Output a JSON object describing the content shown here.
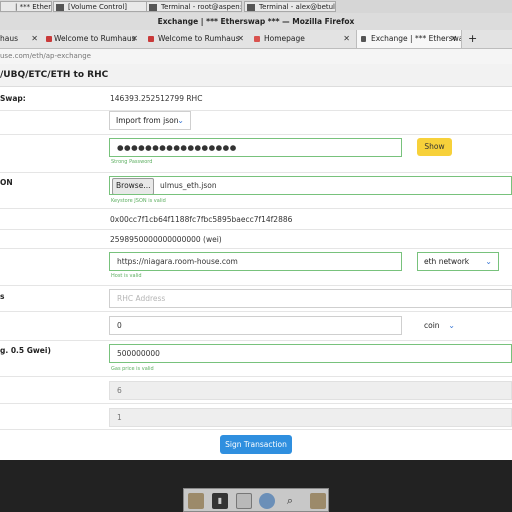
{
  "taskbar": {
    "items": [
      {
        "label": "| *** Ethersw..."
      },
      {
        "label": "[Volume Control]"
      },
      {
        "label": "Terminal - root@aspen:~"
      },
      {
        "label": "Terminal - alex@betula..."
      }
    ]
  },
  "window": {
    "title": "Exchange | *** Etherswap *** — Mozilla Firefox"
  },
  "tabs": [
    {
      "label": "haus"
    },
    {
      "label": "Welcome to Rumhaus"
    },
    {
      "label": "Welcome to Rumhaus"
    },
    {
      "label": "Homepage"
    },
    {
      "label": "Exchange | *** Etherswa"
    }
  ],
  "new_tab_label": "+",
  "url": "use.com/eth/ap-exchange",
  "page": {
    "title": "/UBQ/ETC/ETH to RHC",
    "rows": {
      "swap_label": "Swap:",
      "swap_value": "146393.252512799 RHC",
      "import_select": "Import from json",
      "password_value": "●●●●●●●●●●●●●●●●●",
      "password_hint": "Strong Password",
      "show_button": "Show",
      "json_label": "ON",
      "browse_button": "Browse...",
      "file_name": "ulmus_eth.json",
      "json_hint": "Keystore JSON is valid",
      "address_value": "0x00cc7f1cb64f1188fc7fbc5895baecc7f14f2886",
      "balance_value": "2598950000000000000 (wei)",
      "host_value": "https://niagara.room-house.com",
      "host_hint": "Host is valid",
      "network_select": "eth network",
      "rhc_label": "s",
      "rhc_placeholder": "RHC Address",
      "amount_value": "0",
      "unit_select": "coin",
      "gas_label": "g. 0.5 Gwei)",
      "gas_value": "500000000",
      "gas_hint": "Gas price is valid",
      "field_six": "6",
      "field_one": "1",
      "sign_button": "Sign Transaction"
    }
  },
  "dock": {
    "icons": [
      "folder-icon",
      "terminal-icon",
      "files-icon",
      "browser-icon",
      "search-icon",
      "folder-icon"
    ]
  }
}
